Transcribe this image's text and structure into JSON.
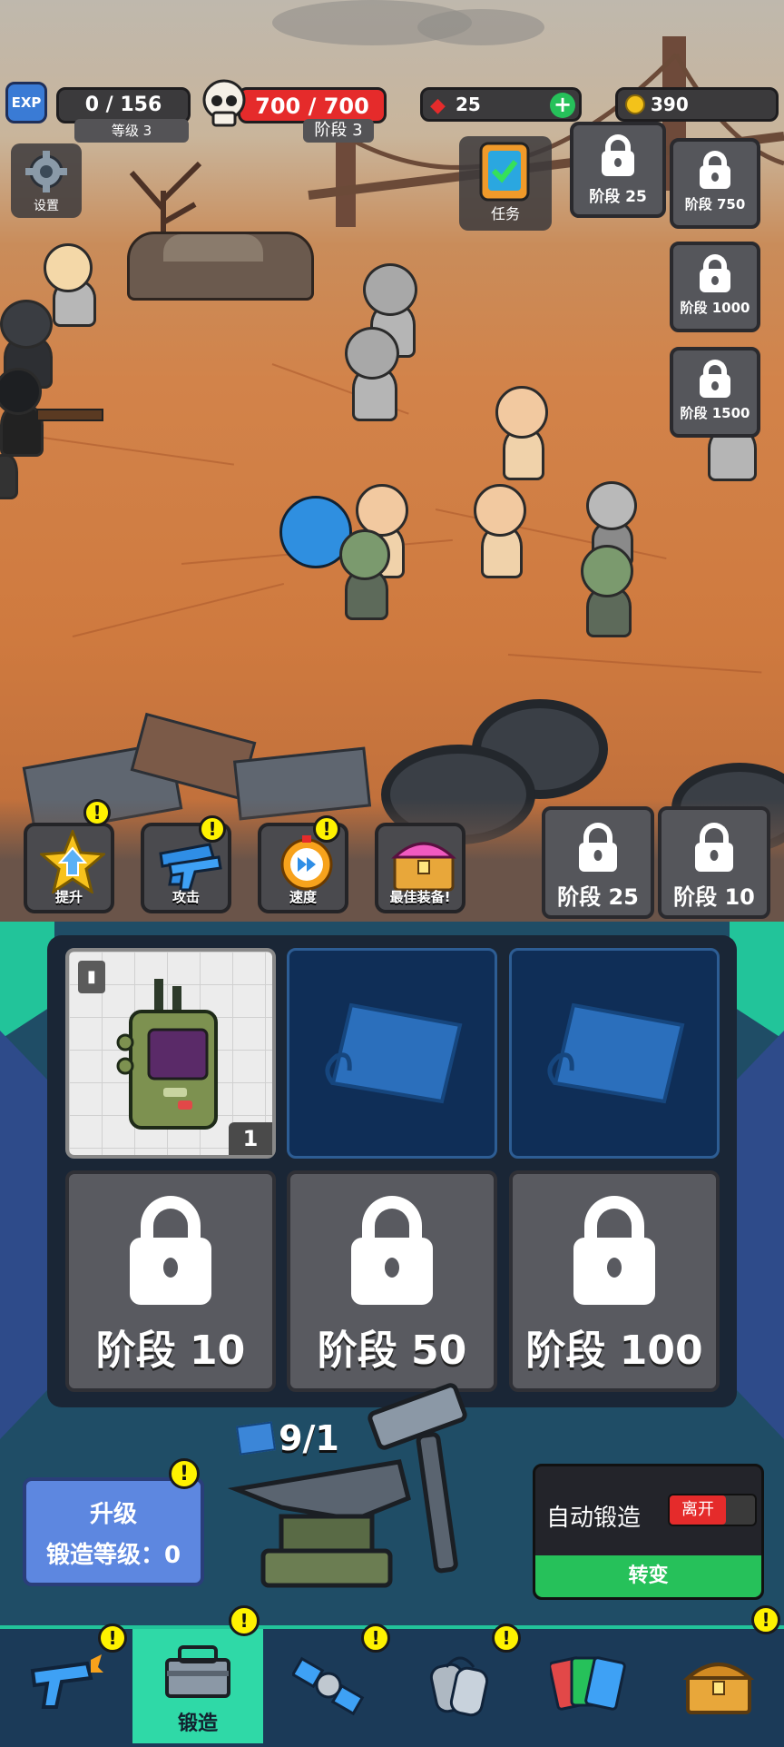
{
  "hud": {
    "exp_badge": "EXP",
    "exp_value": "0 / 156",
    "level_label": "等级 3",
    "hp_value": "700 / 700",
    "stage_label": "阶段 3",
    "gems": "25",
    "coins": "390",
    "settings_label": "设置",
    "tasks_label": "任务"
  },
  "top_locks": [
    {
      "label": "阶段 25"
    },
    {
      "label": "阶段 750"
    },
    {
      "label": "阶段 1000"
    },
    {
      "label": "阶段 1500"
    }
  ],
  "upgrade_buttons": [
    {
      "label": "提升",
      "icon": "arrow-up-star-icon"
    },
    {
      "label": "攻击",
      "icon": "pistols-icon"
    },
    {
      "label": "速度",
      "icon": "stopwatch-icon"
    },
    {
      "label": "最佳装备!",
      "icon": "treasure-chest-icon"
    }
  ],
  "field_locks": [
    {
      "label": "阶段 25"
    },
    {
      "label": "阶段 10"
    }
  ],
  "forge": {
    "filled_slot_count": "1",
    "locked_slots": [
      {
        "label": "阶段 10"
      },
      {
        "label": "阶段 50"
      },
      {
        "label": "阶段 100"
      }
    ],
    "blueprint_count": "9/1",
    "upgrade_title": "升级",
    "upgrade_subtitle": "锻造等级：0",
    "auto_forge_label": "自动锻造",
    "auto_forge_state": "离开",
    "convert_label": "转变"
  },
  "nav": {
    "items": [
      {
        "label": "",
        "icon": "pistol-icon"
      },
      {
        "label": "锻造",
        "icon": "toolbox-icon"
      },
      {
        "label": "",
        "icon": "satellite-icon"
      },
      {
        "label": "",
        "icon": "dog-tags-icon"
      },
      {
        "label": "",
        "icon": "cards-icon"
      },
      {
        "label": "",
        "icon": "chest-icon"
      }
    ],
    "active_index": 1
  },
  "colors": {
    "accent_green": "#2fd9a7",
    "hp_red": "#e52b2b",
    "exp_blue": "#3a7bd5",
    "upgrade_blue": "#5d87e0",
    "notice_yellow": "#fff200"
  }
}
